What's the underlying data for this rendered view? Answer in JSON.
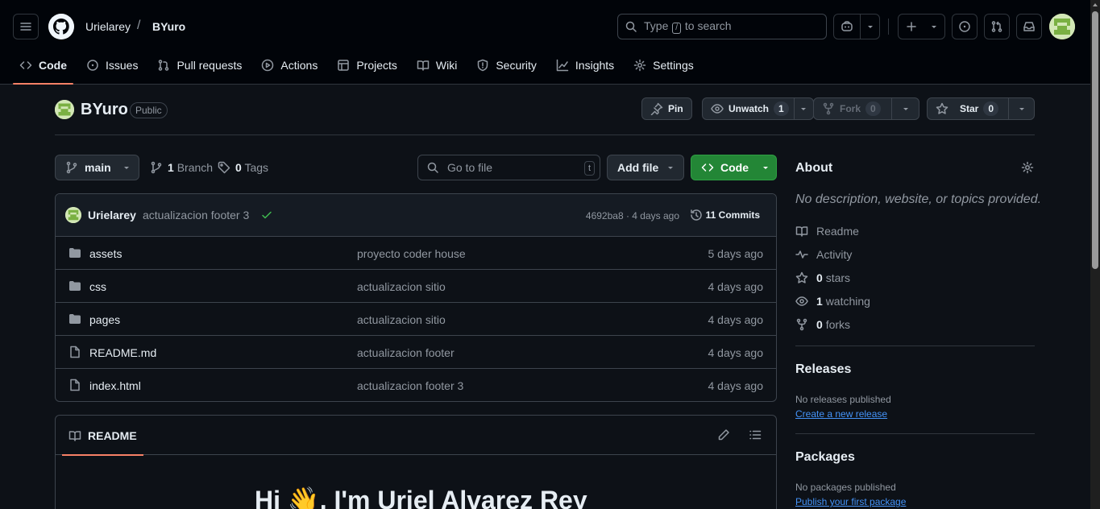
{
  "header": {
    "owner": "Urielarey",
    "separator": "/",
    "repo": "BYuro",
    "search": {
      "prefix": "Type",
      "key": "/",
      "suffix": "to search"
    }
  },
  "nav": [
    {
      "label": "Code",
      "icon": "code-icon",
      "active": true
    },
    {
      "label": "Issues",
      "icon": "issue-icon"
    },
    {
      "label": "Pull requests",
      "icon": "pull-request-icon"
    },
    {
      "label": "Actions",
      "icon": "play-icon"
    },
    {
      "label": "Projects",
      "icon": "table-icon"
    },
    {
      "label": "Wiki",
      "icon": "book-icon"
    },
    {
      "label": "Security",
      "icon": "shield-icon"
    },
    {
      "label": "Insights",
      "icon": "graph-icon"
    },
    {
      "label": "Settings",
      "icon": "gear-icon"
    }
  ],
  "repo": {
    "name": "BYuro",
    "visibility": "Public",
    "pin_label": "Pin",
    "unwatch_label": "Unwatch",
    "unwatch_count": "1",
    "fork_label": "Fork",
    "fork_count": "0",
    "star_label": "Star",
    "star_count": "0"
  },
  "branchbar": {
    "branch": "main",
    "branches_count": "1",
    "branches_label": "Branch",
    "tags_count": "0",
    "tags_label": "Tags",
    "goto_placeholder": "Go to file",
    "goto_key": "t",
    "add_file_label": "Add file",
    "code_label": "Code"
  },
  "latest_commit": {
    "user": "Urielarey",
    "message": "actualizacion footer 3",
    "hash_time": "4692ba8 · 4 days ago",
    "commits_count_label": "11 Commits"
  },
  "files": [
    {
      "type": "folder",
      "name": "assets",
      "message": "proyecto coder house",
      "date": "5 days ago"
    },
    {
      "type": "folder",
      "name": "css",
      "message": "actualizacion sitio",
      "date": "4 days ago"
    },
    {
      "type": "folder",
      "name": "pages",
      "message": "actualizacion sitio",
      "date": "4 days ago"
    },
    {
      "type": "file",
      "name": "README.md",
      "message": "actualizacion footer",
      "date": "4 days ago"
    },
    {
      "type": "file",
      "name": "index.html",
      "message": "actualizacion footer 3",
      "date": "4 days ago"
    }
  ],
  "readme": {
    "tab_label": "README",
    "heading": "Hi 👋, I'm Uriel Alvarez Rey"
  },
  "about": {
    "title": "About",
    "description": "No description, website, or topics provided.",
    "readme_label": "Readme",
    "activity_label": "Activity",
    "stars_count": "0",
    "stars_label": "stars",
    "watching_count": "1",
    "watching_label": "watching",
    "forks_count": "0",
    "forks_label": "forks"
  },
  "releases": {
    "title": "Releases",
    "empty_text": "No releases published",
    "create_link": "Create a new release"
  },
  "packages": {
    "title": "Packages",
    "empty_text": "No packages published",
    "publish_link": "Publish your first package"
  },
  "colors": {
    "background": "#0d1117",
    "header_bg": "#010409",
    "accent_underline": "#f78166",
    "primary_button": "#238636",
    "link": "#4493f8",
    "success": "#3fb950"
  }
}
